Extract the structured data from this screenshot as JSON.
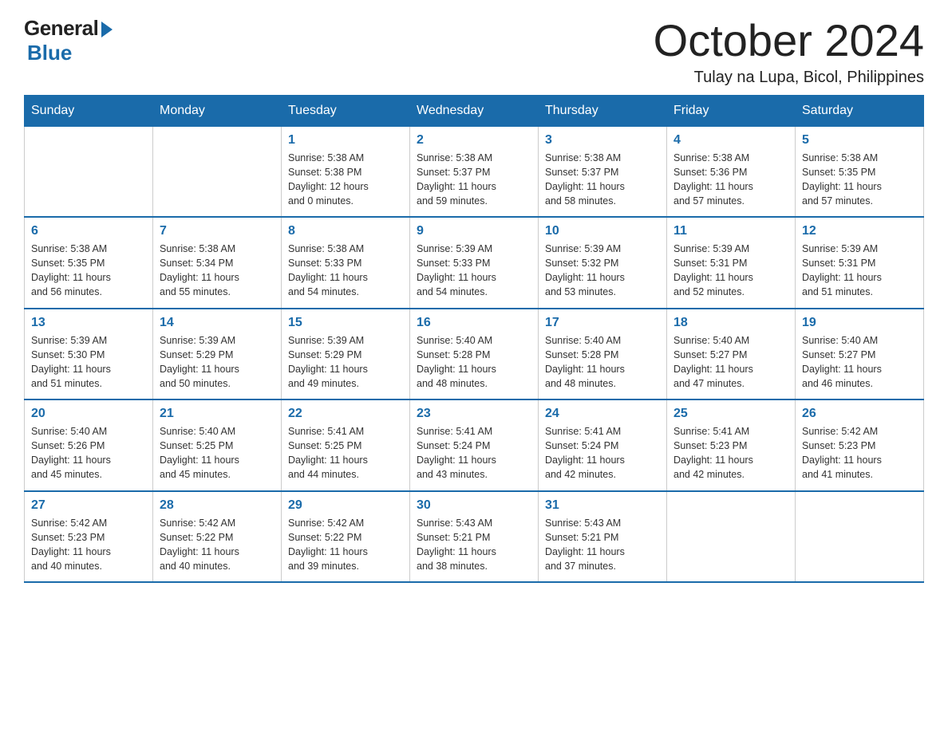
{
  "logo": {
    "general": "General",
    "blue": "Blue"
  },
  "title": {
    "month_year": "October 2024",
    "location": "Tulay na Lupa, Bicol, Philippines"
  },
  "days_of_week": [
    "Sunday",
    "Monday",
    "Tuesday",
    "Wednesday",
    "Thursday",
    "Friday",
    "Saturday"
  ],
  "weeks": [
    [
      {
        "day": "",
        "info": ""
      },
      {
        "day": "",
        "info": ""
      },
      {
        "day": "1",
        "info": "Sunrise: 5:38 AM\nSunset: 5:38 PM\nDaylight: 12 hours\nand 0 minutes."
      },
      {
        "day": "2",
        "info": "Sunrise: 5:38 AM\nSunset: 5:37 PM\nDaylight: 11 hours\nand 59 minutes."
      },
      {
        "day": "3",
        "info": "Sunrise: 5:38 AM\nSunset: 5:37 PM\nDaylight: 11 hours\nand 58 minutes."
      },
      {
        "day": "4",
        "info": "Sunrise: 5:38 AM\nSunset: 5:36 PM\nDaylight: 11 hours\nand 57 minutes."
      },
      {
        "day": "5",
        "info": "Sunrise: 5:38 AM\nSunset: 5:35 PM\nDaylight: 11 hours\nand 57 minutes."
      }
    ],
    [
      {
        "day": "6",
        "info": "Sunrise: 5:38 AM\nSunset: 5:35 PM\nDaylight: 11 hours\nand 56 minutes."
      },
      {
        "day": "7",
        "info": "Sunrise: 5:38 AM\nSunset: 5:34 PM\nDaylight: 11 hours\nand 55 minutes."
      },
      {
        "day": "8",
        "info": "Sunrise: 5:38 AM\nSunset: 5:33 PM\nDaylight: 11 hours\nand 54 minutes."
      },
      {
        "day": "9",
        "info": "Sunrise: 5:39 AM\nSunset: 5:33 PM\nDaylight: 11 hours\nand 54 minutes."
      },
      {
        "day": "10",
        "info": "Sunrise: 5:39 AM\nSunset: 5:32 PM\nDaylight: 11 hours\nand 53 minutes."
      },
      {
        "day": "11",
        "info": "Sunrise: 5:39 AM\nSunset: 5:31 PM\nDaylight: 11 hours\nand 52 minutes."
      },
      {
        "day": "12",
        "info": "Sunrise: 5:39 AM\nSunset: 5:31 PM\nDaylight: 11 hours\nand 51 minutes."
      }
    ],
    [
      {
        "day": "13",
        "info": "Sunrise: 5:39 AM\nSunset: 5:30 PM\nDaylight: 11 hours\nand 51 minutes."
      },
      {
        "day": "14",
        "info": "Sunrise: 5:39 AM\nSunset: 5:29 PM\nDaylight: 11 hours\nand 50 minutes."
      },
      {
        "day": "15",
        "info": "Sunrise: 5:39 AM\nSunset: 5:29 PM\nDaylight: 11 hours\nand 49 minutes."
      },
      {
        "day": "16",
        "info": "Sunrise: 5:40 AM\nSunset: 5:28 PM\nDaylight: 11 hours\nand 48 minutes."
      },
      {
        "day": "17",
        "info": "Sunrise: 5:40 AM\nSunset: 5:28 PM\nDaylight: 11 hours\nand 48 minutes."
      },
      {
        "day": "18",
        "info": "Sunrise: 5:40 AM\nSunset: 5:27 PM\nDaylight: 11 hours\nand 47 minutes."
      },
      {
        "day": "19",
        "info": "Sunrise: 5:40 AM\nSunset: 5:27 PM\nDaylight: 11 hours\nand 46 minutes."
      }
    ],
    [
      {
        "day": "20",
        "info": "Sunrise: 5:40 AM\nSunset: 5:26 PM\nDaylight: 11 hours\nand 45 minutes."
      },
      {
        "day": "21",
        "info": "Sunrise: 5:40 AM\nSunset: 5:25 PM\nDaylight: 11 hours\nand 45 minutes."
      },
      {
        "day": "22",
        "info": "Sunrise: 5:41 AM\nSunset: 5:25 PM\nDaylight: 11 hours\nand 44 minutes."
      },
      {
        "day": "23",
        "info": "Sunrise: 5:41 AM\nSunset: 5:24 PM\nDaylight: 11 hours\nand 43 minutes."
      },
      {
        "day": "24",
        "info": "Sunrise: 5:41 AM\nSunset: 5:24 PM\nDaylight: 11 hours\nand 42 minutes."
      },
      {
        "day": "25",
        "info": "Sunrise: 5:41 AM\nSunset: 5:23 PM\nDaylight: 11 hours\nand 42 minutes."
      },
      {
        "day": "26",
        "info": "Sunrise: 5:42 AM\nSunset: 5:23 PM\nDaylight: 11 hours\nand 41 minutes."
      }
    ],
    [
      {
        "day": "27",
        "info": "Sunrise: 5:42 AM\nSunset: 5:23 PM\nDaylight: 11 hours\nand 40 minutes."
      },
      {
        "day": "28",
        "info": "Sunrise: 5:42 AM\nSunset: 5:22 PM\nDaylight: 11 hours\nand 40 minutes."
      },
      {
        "day": "29",
        "info": "Sunrise: 5:42 AM\nSunset: 5:22 PM\nDaylight: 11 hours\nand 39 minutes."
      },
      {
        "day": "30",
        "info": "Sunrise: 5:43 AM\nSunset: 5:21 PM\nDaylight: 11 hours\nand 38 minutes."
      },
      {
        "day": "31",
        "info": "Sunrise: 5:43 AM\nSunset: 5:21 PM\nDaylight: 11 hours\nand 37 minutes."
      },
      {
        "day": "",
        "info": ""
      },
      {
        "day": "",
        "info": ""
      }
    ]
  ]
}
